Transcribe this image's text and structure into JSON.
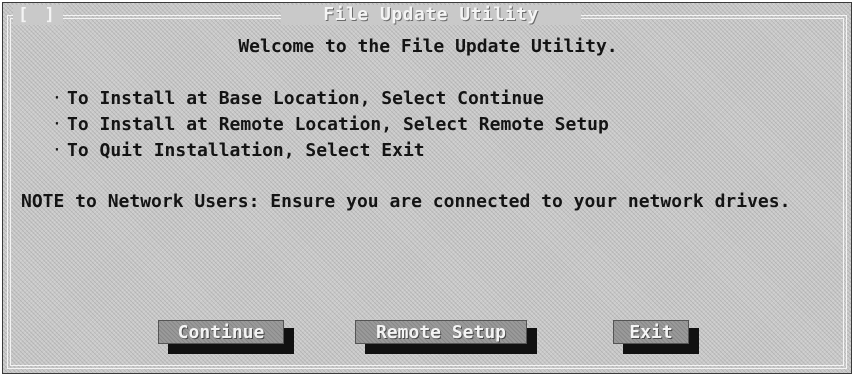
{
  "window": {
    "title": "File Update Utility",
    "close_box": "[ ]"
  },
  "content": {
    "welcome": "Welcome to the File Update Utility.",
    "bullet_symbol": "·",
    "options": [
      "To Install at Base Location, Select Continue",
      "To Install at Remote Location, Select Remote Setup",
      "To Quit Installation, Select Exit"
    ],
    "note": "NOTE to Network Users: Ensure you are connected to your network drives."
  },
  "buttons": {
    "continue": "Continue",
    "remote_setup": "Remote Setup",
    "exit": "Exit"
  },
  "colors": {
    "dialog_background": "#c9c9c9",
    "frame": "#f4f4f4",
    "text": "#141414",
    "button_face": "#9a9a9a",
    "button_shadow": "#111111"
  }
}
